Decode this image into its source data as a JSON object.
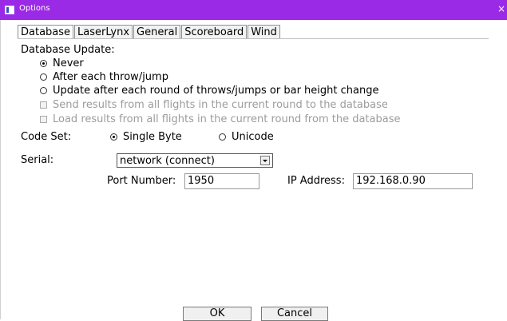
{
  "window": {
    "title": "Options",
    "close_glyph": "×"
  },
  "tabs": [
    {
      "label": "Database",
      "active": true
    },
    {
      "label": "LaserLynx",
      "active": false
    },
    {
      "label": "General",
      "active": false
    },
    {
      "label": "Scoreboard",
      "active": false
    },
    {
      "label": "Wind",
      "active": false
    }
  ],
  "database_update": {
    "heading": "Database Update:",
    "options": [
      {
        "label": "Never",
        "selected": true
      },
      {
        "label": "After each throw/jump",
        "selected": false
      },
      {
        "label": "Update after each round of throws/jumps or bar height change",
        "selected": false
      }
    ],
    "checkboxes": [
      {
        "label": "Send results from all flights in the current round to the database",
        "checked": false,
        "enabled": false
      },
      {
        "label": "Load results from all flights in the current round from the database",
        "checked": false,
        "enabled": false
      }
    ]
  },
  "code_set": {
    "label": "Code Set:",
    "options": [
      {
        "label": "Single Byte",
        "selected": true
      },
      {
        "label": "Unicode",
        "selected": false
      }
    ]
  },
  "serial": {
    "label": "Serial:",
    "selected": "network (connect)",
    "port_label": "Port Number:",
    "port_value": "1950",
    "ip_label": "IP Address:",
    "ip_value": "192.168.0.90"
  },
  "buttons": {
    "ok": "OK",
    "cancel": "Cancel"
  }
}
